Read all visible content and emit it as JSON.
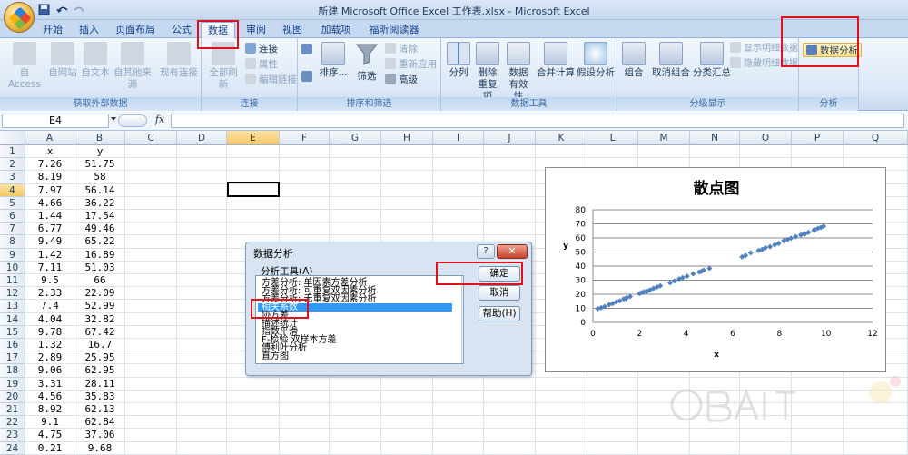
{
  "window": {
    "title": "新建 Microsoft Office Excel 工作表.xlsx - Microsoft Excel"
  },
  "tabs": [
    "开始",
    "插入",
    "页面布局",
    "公式",
    "数据",
    "审阅",
    "视图",
    "加载项",
    "福昕阅读器"
  ],
  "active_tab": "数据",
  "ribbon": {
    "groups": {
      "external": "获取外部数据",
      "connections": "连接",
      "sort_filter": "排序和筛选",
      "data_tools": "数据工具",
      "outline": "分级显示",
      "analysis": "分析"
    },
    "external": {
      "access": "自 Access",
      "web": "自网站",
      "text": "自文本",
      "other": "自其他来源",
      "existing": "现有连接"
    },
    "connections": {
      "refresh_all": "全部刷新",
      "connections": "连接",
      "properties": "属性",
      "edit_links": "编辑链接"
    },
    "sort_filter": {
      "sort": "排序...",
      "filter": "筛选",
      "clear": "清除",
      "reapply": "重新应用",
      "advanced": "高级"
    },
    "data_tools": {
      "text_to_columns": "分列",
      "remove_dup_1": "删除",
      "remove_dup_2": "重复项",
      "validation_1": "数据",
      "validation_2": "有效性",
      "consolidate": "合并计算",
      "what_if": "假设分析"
    },
    "outline": {
      "group": "组合",
      "ungroup": "取消组合",
      "subtotal": "分类汇总",
      "show_detail": "显示明细数据",
      "hide_detail": "隐藏明细数据"
    },
    "analysis": {
      "data_analysis": "数据分析"
    }
  },
  "formula_bar": {
    "name_box": "E4",
    "fx": "fx",
    "value": ""
  },
  "sheet": {
    "columns": [
      "A",
      "B",
      "C",
      "D",
      "E",
      "F",
      "G",
      "H",
      "I",
      "J",
      "K",
      "L",
      "M",
      "N",
      "O",
      "P",
      "Q"
    ],
    "rows": [
      "1",
      "2",
      "3",
      "4",
      "5",
      "6",
      "7",
      "8",
      "9",
      "10",
      "11",
      "12",
      "13",
      "14",
      "15",
      "16",
      "17",
      "18",
      "19",
      "20",
      "21",
      "22",
      "23",
      "24"
    ],
    "header_row": [
      "x",
      "y"
    ],
    "data": [
      [
        "7.26",
        "51.75"
      ],
      [
        "8.19",
        "58"
      ],
      [
        "7.97",
        "56.14"
      ],
      [
        "4.66",
        "36.22"
      ],
      [
        "1.44",
        "17.54"
      ],
      [
        "6.77",
        "49.46"
      ],
      [
        "9.49",
        "65.22"
      ],
      [
        "1.42",
        "16.89"
      ],
      [
        "7.11",
        "51.03"
      ],
      [
        "9.5",
        "66"
      ],
      [
        "2.33",
        "22.09"
      ],
      [
        "7.4",
        "52.99"
      ],
      [
        "4.04",
        "32.82"
      ],
      [
        "9.78",
        "67.42"
      ],
      [
        "1.32",
        "16.7"
      ],
      [
        "2.89",
        "25.95"
      ],
      [
        "9.06",
        "62.95"
      ],
      [
        "3.31",
        "28.11"
      ],
      [
        "4.56",
        "35.83"
      ],
      [
        "8.92",
        "62.13"
      ],
      [
        "9.1",
        "62.84"
      ],
      [
        "4.75",
        "37.06"
      ],
      [
        "0.21",
        "9.68"
      ]
    ]
  },
  "dialog": {
    "title": "数据分析",
    "help": "?",
    "close": "✕",
    "label": "分析工具(A)",
    "tools": [
      "方差分析: 单因素方差分析",
      "方差分析: 可重复双因素分析",
      "方差分析: 无重复双因素分析",
      "相关系数",
      "协方差",
      "描述统计",
      "指数平滑",
      "F-检验 双样本方差",
      "傅利叶分析",
      "直方图"
    ],
    "selected_tool": "相关系数",
    "ok": "确定",
    "cancel": "取消",
    "help_btn": "帮助(H)"
  },
  "chart_data": {
    "type": "scatter",
    "title": "散点图",
    "xlabel": "x",
    "ylabel": "y",
    "xlim": [
      0,
      12
    ],
    "ylim": [
      0,
      80
    ],
    "xticks": [
      0,
      2,
      4,
      6,
      8,
      10,
      12
    ],
    "yticks": [
      0,
      10,
      20,
      30,
      40,
      50,
      60,
      70,
      80
    ],
    "grid": true,
    "color": "#4f81bd",
    "points": [
      [
        0.21,
        9.68
      ],
      [
        0.35,
        10.4
      ],
      [
        0.5,
        11.3
      ],
      [
        0.7,
        12.6
      ],
      [
        0.85,
        13.4
      ],
      [
        1.0,
        14.5
      ],
      [
        1.15,
        15.3
      ],
      [
        1.32,
        16.7
      ],
      [
        1.42,
        16.89
      ],
      [
        1.44,
        17.54
      ],
      [
        1.6,
        18.4
      ],
      [
        2.0,
        20.5
      ],
      [
        2.1,
        21.2
      ],
      [
        2.2,
        21.8
      ],
      [
        2.33,
        22.09
      ],
      [
        2.45,
        23.1
      ],
      [
        2.6,
        24.2
      ],
      [
        2.75,
        25.1
      ],
      [
        2.89,
        25.95
      ],
      [
        3.31,
        28.11
      ],
      [
        3.5,
        29.4
      ],
      [
        3.7,
        30.9
      ],
      [
        3.85,
        31.8
      ],
      [
        4.04,
        32.82
      ],
      [
        4.3,
        34.5
      ],
      [
        4.56,
        35.83
      ],
      [
        4.66,
        36.22
      ],
      [
        4.75,
        37.06
      ],
      [
        5.0,
        38.4
      ],
      [
        6.4,
        46.5
      ],
      [
        6.55,
        47.6
      ],
      [
        6.77,
        49.46
      ],
      [
        7.11,
        51.03
      ],
      [
        7.26,
        51.75
      ],
      [
        7.4,
        52.99
      ],
      [
        7.6,
        53.8
      ],
      [
        7.8,
        55.1
      ],
      [
        7.97,
        56.14
      ],
      [
        8.19,
        58
      ],
      [
        8.35,
        58.9
      ],
      [
        8.5,
        59.8
      ],
      [
        8.7,
        61.0
      ],
      [
        8.92,
        62.13
      ],
      [
        9.06,
        62.95
      ],
      [
        9.1,
        62.84
      ],
      [
        9.25,
        64.0
      ],
      [
        9.49,
        65.22
      ],
      [
        9.5,
        66
      ],
      [
        9.65,
        66.8
      ],
      [
        9.78,
        67.42
      ],
      [
        9.9,
        68.3
      ]
    ]
  }
}
